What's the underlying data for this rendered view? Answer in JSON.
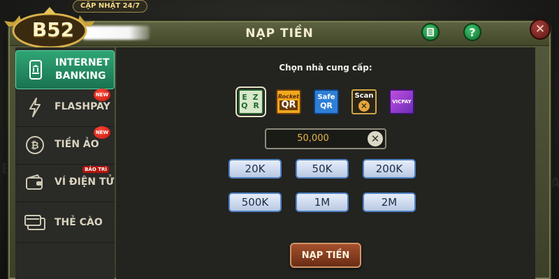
{
  "logo": {
    "text": "B52"
  },
  "update_tag": "CẬP NHẬT 24/7",
  "dialog": {
    "title": "NẠP TIỀN",
    "close_label": "✕"
  },
  "sidebar": {
    "items": [
      {
        "label_line1": "INTERNET",
        "label_line2": "BANKING",
        "active": true,
        "icon": "bank-phone-icon"
      },
      {
        "label_line1": "FLASHPAY",
        "active": false,
        "icon": "lightning-icon",
        "badge": "NEW"
      },
      {
        "label_line1": "TIỀN ẢO",
        "active": false,
        "icon": "bitcoin-icon",
        "badge": "NEW"
      },
      {
        "label_line1": "VÍ ĐIỆN TỬ",
        "active": false,
        "icon": "wallet-icon",
        "badge": "BẢO TRÌ"
      },
      {
        "label_line1": "THẺ CÀO",
        "active": false,
        "icon": "card-icon"
      }
    ]
  },
  "content": {
    "subtitle": "Chọn nhà cung cấp:",
    "providers": [
      {
        "name": "EZQR",
        "line1": "E Z",
        "line2": "Q R",
        "selected": true
      },
      {
        "name": "Rocket QR",
        "line1": "Rocket",
        "line2": "QR"
      },
      {
        "name": "Safe QR",
        "line1": "Safe",
        "line2": "QR"
      },
      {
        "name": "Scan",
        "line1": "Scan",
        "line2": "✕"
      },
      {
        "name": "VICPAY",
        "line1": "VICPAY"
      }
    ],
    "amount_value": "50,000",
    "amounts": [
      "20K",
      "50K",
      "200K",
      "500K",
      "1M",
      "2M"
    ],
    "submit_label": "NẠP TIỀN"
  },
  "colors": {
    "accent_green": "#2fa574",
    "amount_text": "#e8b84a",
    "amount_button_border": "#4e81c3",
    "submit_button": "#8a3e1f"
  }
}
